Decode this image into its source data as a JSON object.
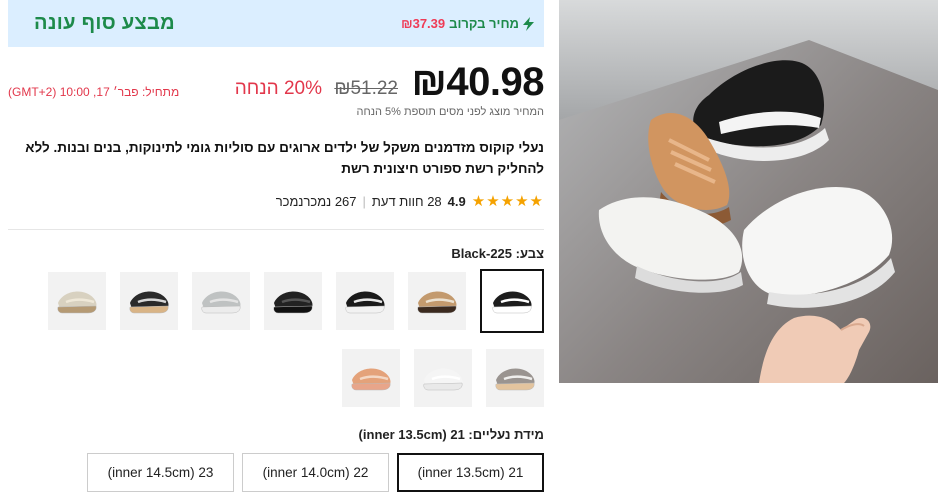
{
  "banner": {
    "title": "מבצע סוף עונה",
    "next_label": "מחיר בקרוב",
    "next_price": "₪37.39"
  },
  "price": {
    "current": "₪40.98",
    "original": "₪51.22",
    "discount": "20% הנחה",
    "ends": "מתחיל:  פבר׳ 17, 10:00 (GMT+2)",
    "tax_note": "המחיר מוצג לפני מסים תוספת 5% הנחה"
  },
  "product": {
    "title": "נעלי קוקוס מזדמנים משקל של ילדים ארוגים עם סוליות גומי לתינוקות, בנים ובנות. ללא להחליק רשת ספורט חיצונית רשת"
  },
  "rating": {
    "stars": "★★★★★",
    "score": "4.9",
    "reviews": "28 חוות דעת",
    "sold": "267 נמכרנמכר"
  },
  "color": {
    "label": "צבע: Black-225",
    "selected_index": 0,
    "options": [
      {
        "name": "black-225",
        "upper": "#1d1d1d",
        "sole": "#ffffff",
        "stripe": "#ffffff"
      },
      {
        "name": "tan",
        "upper": "#c39a6e",
        "sole": "#3b2a1f",
        "stripe": "#ece2d2"
      },
      {
        "name": "black-white",
        "upper": "#1a1a1a",
        "sole": "#f2f2f2",
        "stripe": "#e8e8e8"
      },
      {
        "name": "black-sole",
        "upper": "#222222",
        "sole": "#111111",
        "stripe": "#555555"
      },
      {
        "name": "grey",
        "upper": "#bfc2c2",
        "sole": "#ececec",
        "stripe": "#e4e4e4"
      },
      {
        "name": "black-gum",
        "upper": "#2a2a2a",
        "sole": "#d9b486",
        "stripe": "#d7d7d7"
      },
      {
        "name": "cream",
        "upper": "#d8d1c0",
        "sole": "#b59a74",
        "stripe": "#efe8d8"
      },
      {
        "name": "zebra",
        "upper": "#9a9490",
        "sole": "#e3c49e",
        "stripe": "#f0efed"
      },
      {
        "name": "white",
        "upper": "#f5f5f5",
        "sole": "#e9e9e9",
        "stripe": "#ffffff"
      },
      {
        "name": "orange",
        "upper": "#e4a27a",
        "sole": "#e8a58a",
        "stripe": "#f3d7c4"
      }
    ]
  },
  "size": {
    "label": "מידת נעליים: 21 (inner 13.5cm)",
    "options": [
      "21 (inner 13.5cm)",
      "22 (inner 14.0cm)",
      "23 (inner 14.5cm)"
    ],
    "selected_index": 0
  },
  "icons": {
    "bolt": "lightning-icon",
    "star": "star-icon"
  },
  "colors": {
    "accent_green": "#1d8a4a",
    "sale_red": "#e2374b",
    "banner_bg": "#dbeeff",
    "star": "#f5a200"
  }
}
